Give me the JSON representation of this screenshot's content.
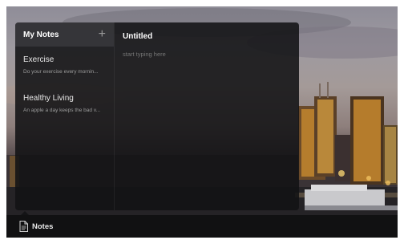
{
  "notes_app": {
    "sidebar_title": "My Notes",
    "add_icon": "plus-icon",
    "notes": [
      {
        "title": "Exercise",
        "preview": "Do your exercise every mornin..."
      },
      {
        "title": "Healthy Living",
        "preview": "An apple a day keeps the bad v..."
      }
    ],
    "editor": {
      "title": "Untitled",
      "placeholder": "start typing here"
    }
  },
  "taskbar": {
    "app_icon": "document-icon",
    "app_label": "Notes"
  }
}
